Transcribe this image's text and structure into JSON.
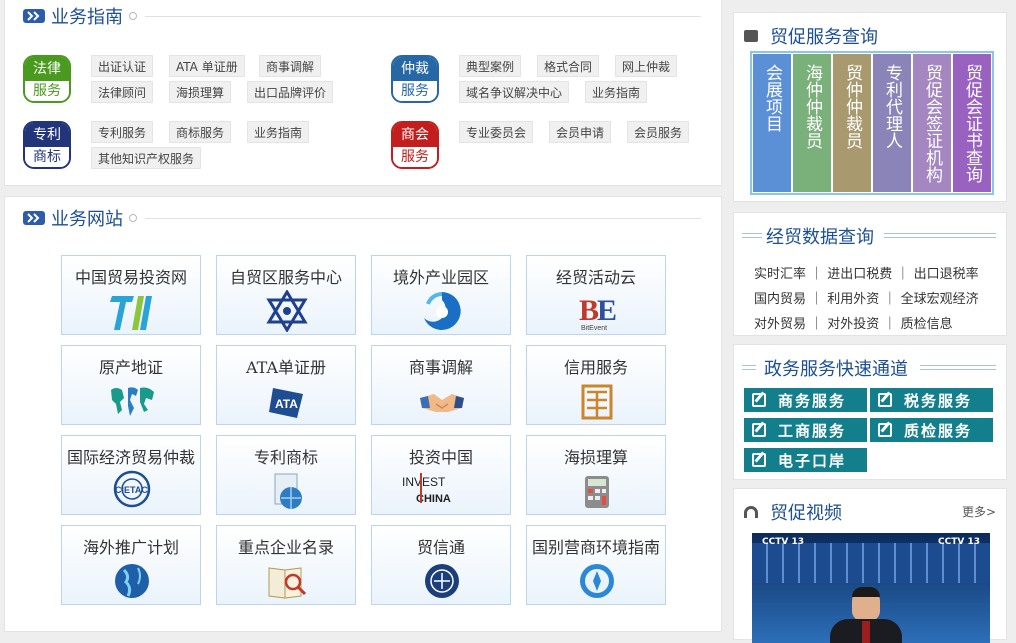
{
  "guide": {
    "title": "业务指南",
    "groups": [
      {
        "top": "法律",
        "bottom": "服务",
        "color": "#4a9a1f"
      },
      {
        "top": "仲裁",
        "bottom": "服务",
        "color": "#2668a6"
      },
      {
        "top": "专利",
        "bottom": "商标",
        "color": "#22347a"
      },
      {
        "top": "商会",
        "bottom": "服务",
        "color": "#c31d1d"
      }
    ],
    "tags": {
      "legal": [
        "出证认证",
        "ATA 单证册",
        "商事调解",
        "法律顾问",
        "海损理算",
        "出口品牌评价"
      ],
      "arb": [
        "典型案例",
        "格式合同",
        "网上仲裁",
        "域名争议解决中心",
        "业务指南"
      ],
      "patent": [
        "专利服务",
        "商标服务",
        "业务指南",
        "其他知识产权服务"
      ],
      "chamber": [
        "专业委员会",
        "会员申请",
        "会员服务"
      ]
    }
  },
  "sites": {
    "title": "业务网站",
    "tiles": [
      "中国贸易投资网",
      "自贸区服务中心",
      "境外产业园区",
      "经贸活动云",
      "原产地证",
      "ATA单证册",
      "商事调解",
      "信用服务",
      "国际经济贸易仲裁",
      "专利商标",
      "投资中国",
      "海损理算",
      "海外推广计划",
      "重点企业名录",
      "贸信通",
      "国别营商环境指南"
    ],
    "logo_texts": {
      "bit": "BitEvent",
      "cietac": "CIETAC",
      "invest": "INVEST",
      "china": "CHINA"
    }
  },
  "query": {
    "title": "贸促服务查询",
    "columns": [
      {
        "text": "会展项目",
        "color": "#5b8fd6"
      },
      {
        "text": "海仲仲裁员",
        "color": "#7ab07a"
      },
      {
        "text": "贸仲仲裁员",
        "color": "#a89a6e"
      },
      {
        "text": "专利代理人",
        "color": "#8a84b8"
      },
      {
        "text": "贸促会签证机构",
        "color": "#a486c0"
      },
      {
        "text": "贸促会证书查询",
        "color": "#9a62c0"
      }
    ]
  },
  "data_query": {
    "title": "经贸数据查询",
    "rows": [
      [
        "实时汇率",
        "进出口税费",
        "出口退税率"
      ],
      [
        "国内贸易",
        "利用外资",
        "全球宏观经济"
      ],
      [
        "对外贸易",
        "对外投资",
        "质检信息"
      ]
    ]
  },
  "gov": {
    "title": "政务服务快速通道",
    "buttons": [
      "商务服务",
      "税务服务",
      "工商服务",
      "质检服务",
      "电子口岸"
    ]
  },
  "video": {
    "title": "贸促视频",
    "more": "更多>",
    "channel": "CCTV 13"
  }
}
